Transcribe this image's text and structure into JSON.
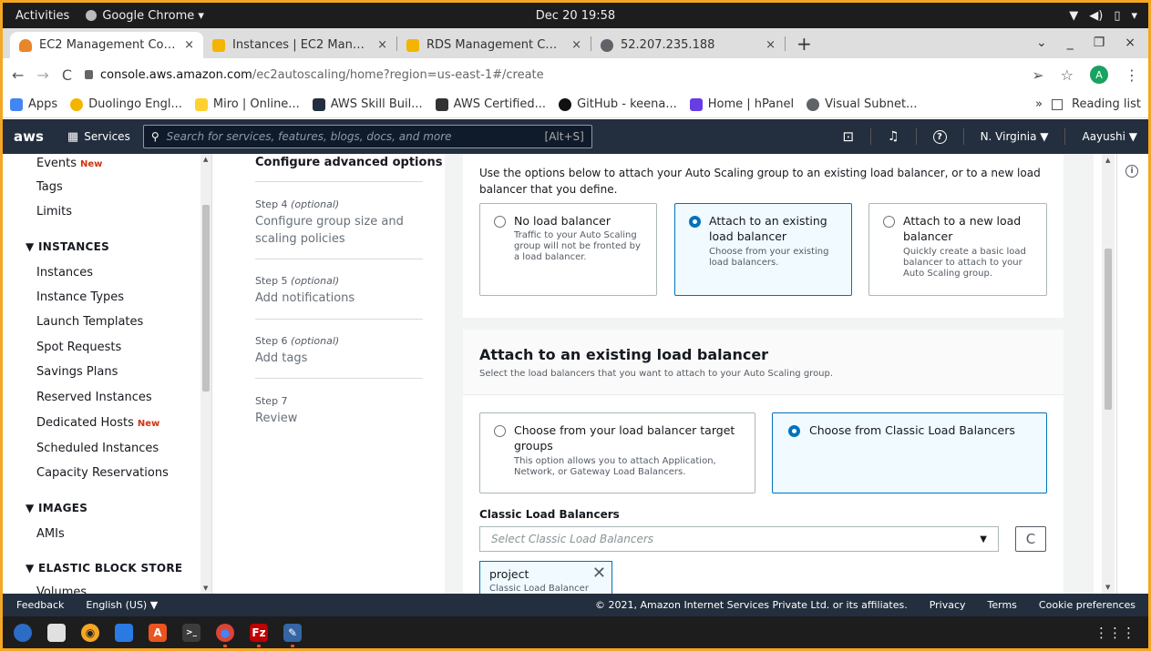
{
  "gnome": {
    "activities": "Activities",
    "app": "Google Chrome ▾",
    "clock": "Dec 20  19:58",
    "tray": [
      "▼",
      "◀)",
      "▯",
      "▾"
    ]
  },
  "tabs": [
    {
      "title": "EC2 Management Console",
      "close": "×",
      "color": "#e8862a"
    },
    {
      "title": "Instances | EC2 Management",
      "close": "×",
      "color": "#f5b400"
    },
    {
      "title": "RDS Management Console",
      "close": "×",
      "color": "#f5b400"
    },
    {
      "title": "52.207.235.188",
      "close": "×",
      "color": "#5f6368"
    }
  ],
  "browser": {
    "new_tab": "+",
    "win_controls": [
      "⌄",
      "_",
      "❐",
      "×"
    ],
    "back": "←",
    "forward": "→",
    "reload": "C",
    "lock": "🔒",
    "url_host": "console.aws.amazon.com",
    "url_path": "/ec2autoscaling/home?region=us-east-1#/create",
    "avatar": "A",
    "menu": "⋮",
    "share": "➢",
    "star": "☆"
  },
  "bookmarks": [
    {
      "label": "Apps",
      "color": "#4285f4"
    },
    {
      "label": "Duolingo Engl...",
      "color": "#f5b400"
    },
    {
      "label": "Miro | Online...",
      "color": "#ffd02f"
    },
    {
      "label": "AWS Skill Buil...",
      "color": "#232f3e"
    },
    {
      "label": "AWS Certified...",
      "color": "#333333"
    },
    {
      "label": "GitHub - keena...",
      "color": "#111111"
    },
    {
      "label": "Home | hPanel",
      "color": "#673de6"
    },
    {
      "label": "Visual Subnet...",
      "color": "#5f6368"
    }
  ],
  "bookmarks_more": "»",
  "reading_list": "Reading list",
  "aws": {
    "logo": "aws",
    "services": "Services",
    "search_placeholder": "Search for services, features, blogs, docs, and more",
    "search_hint": "[Alt+S]",
    "region": "N. Virginia ▼",
    "user": "Aayushi ▼",
    "cloudshell": "⊡",
    "bell": "🔔",
    "help": "?"
  },
  "nav": {
    "events": "Events",
    "new": "New",
    "tags": "Tags",
    "limits": "Limits",
    "instances_section": "▼  INSTANCES",
    "instances": "Instances",
    "instance_types": "Instance Types",
    "launch_templates": "Launch Templates",
    "spot_requests": "Spot Requests",
    "savings_plans": "Savings Plans",
    "reserved_instances": "Reserved Instances",
    "dedicated_hosts": "Dedicated Hosts",
    "scheduled_instances": "Scheduled Instances",
    "capacity_reservations": "Capacity Reservations",
    "images_section": "▼  IMAGES",
    "amis": "AMIs",
    "ebs_section": "▼  ELASTIC BLOCK STORE",
    "volumes": "Volumes"
  },
  "steps": {
    "current": "Configure advanced options",
    "step4_label": "Step 4",
    "optional": "(optional)",
    "step4_title_1": "Configure group size and",
    "step4_title_2": "scaling policies",
    "step5_label": "Step 5",
    "step5_title": "Add notifications",
    "step6_label": "Step 6",
    "step6_title": "Add tags",
    "step7_label": "Step 7",
    "step7_title": "Review"
  },
  "lb": {
    "intro_1": "Use the options below to attach your Auto Scaling group to an existing load balancer, or to a new load",
    "intro_2": "balancer that you define.",
    "opt_none_title": "No load balancer",
    "opt_none_desc_1": "Traffic to your Auto Scaling",
    "opt_none_desc_2": "group will not be fronted by",
    "opt_none_desc_3": "a load balancer.",
    "opt_existing_title_1": "Attach to an existing",
    "opt_existing_title_2": "load balancer",
    "opt_existing_desc_1": "Choose from your existing",
    "opt_existing_desc_2": "load balancers.",
    "opt_new_title_1": "Attach to a new load",
    "opt_new_title_2": "balancer",
    "opt_new_desc_1": "Quickly create a basic load",
    "opt_new_desc_2": "balancer to attach to your",
    "opt_new_desc_3": "Auto Scaling group."
  },
  "existing": {
    "heading": "Attach to an existing load balancer",
    "subheading": "Select the load balancers that you want to attach to your Auto Scaling group.",
    "tg_title_1": "Choose from your load balancer target",
    "tg_title_2": "groups",
    "tg_desc_1": "This option allows you to attach Application,",
    "tg_desc_2": "Network, or Gateway Load Balancers.",
    "classic_title": "Choose from Classic Load Balancers",
    "classic_label": "Classic Load Balancers",
    "select_placeholder": "Select Classic Load Balancers",
    "caret": "▼",
    "refresh": "C",
    "token_name": "project",
    "token_desc": "Classic Load Balancer",
    "token_close": "✕"
  },
  "footer": {
    "feedback": "Feedback",
    "language": "English (US) ▼",
    "copyright": "© 2021, Amazon Internet Services Private Ltd. or its affiliates.",
    "privacy": "Privacy",
    "terms": "Terms",
    "cookies": "Cookie preferences"
  },
  "dock": {
    "grid": "⋮⋮⋮",
    "apps": [
      {
        "name": "thunderbird",
        "color": "#2b6cc4",
        "glyph": "",
        "dot": false
      },
      {
        "name": "files",
        "color": "#e0e0e0",
        "glyph": "",
        "dot": false
      },
      {
        "name": "rhythmbox",
        "color": "#f5a623",
        "glyph": "◉",
        "dot": false
      },
      {
        "name": "writer",
        "color": "#2a7ae4",
        "glyph": "",
        "dot": false
      },
      {
        "name": "software",
        "color": "#e95420",
        "glyph": "A",
        "dot": false
      },
      {
        "name": "terminal",
        "color": "#3c3c3c",
        "glyph": ">_",
        "dot": false
      },
      {
        "name": "chrome",
        "color": "#db4437",
        "glyph": "●",
        "dot": true
      },
      {
        "name": "filezilla",
        "color": "#bf0000",
        "glyph": "Fz",
        "dot": true
      },
      {
        "name": "text-editor",
        "color": "#3465a4",
        "glyph": "✎",
        "dot": true
      }
    ]
  }
}
